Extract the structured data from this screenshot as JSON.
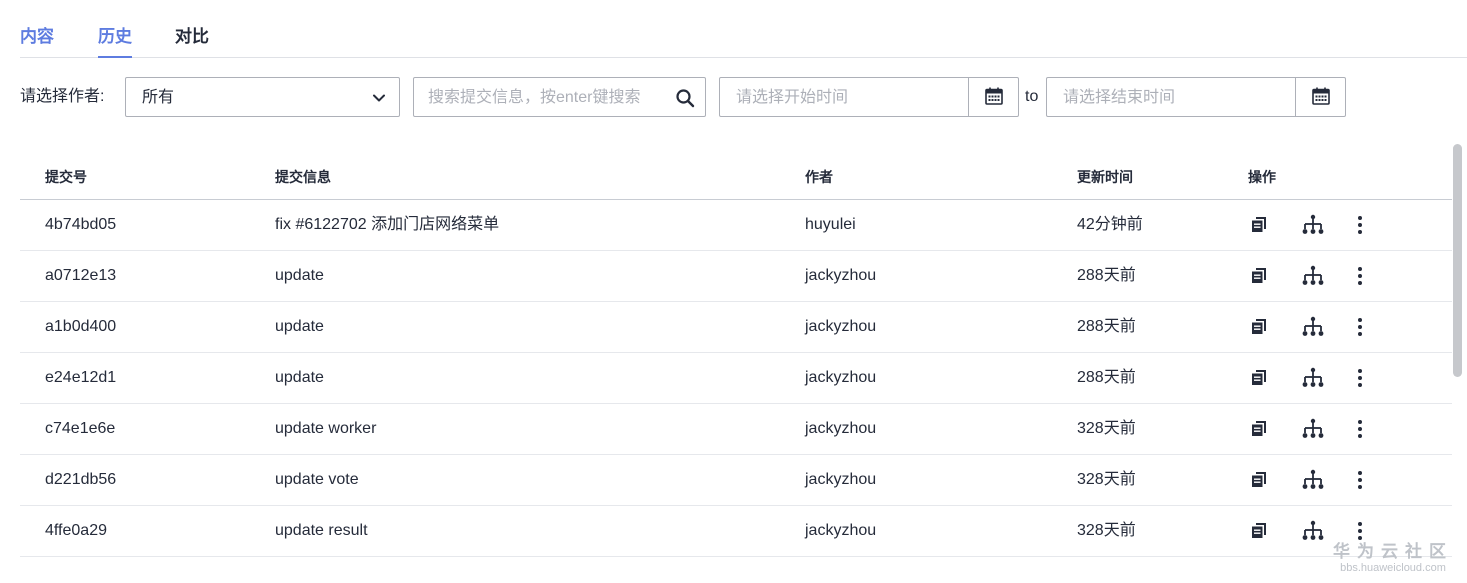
{
  "tabs": [
    {
      "label": "内容"
    },
    {
      "label": "历史"
    },
    {
      "label": "对比"
    }
  ],
  "filters": {
    "author_label": "请选择作者:",
    "author_value": "所有",
    "search_placeholder": "搜索提交信息，按enter键搜索",
    "start_placeholder": "请选择开始时间",
    "to_label": "to",
    "end_placeholder": "请选择结束时间"
  },
  "table": {
    "headers": [
      "提交号",
      "提交信息",
      "作者",
      "更新时间",
      "操作"
    ],
    "rows": [
      {
        "commit": "4b74bd05",
        "message": "fix #6122702 添加门店网络菜单",
        "author": "huyulei",
        "time": "42分钟前"
      },
      {
        "commit": "a0712e13",
        "message": "update",
        "author": "jackyzhou",
        "time": "288天前"
      },
      {
        "commit": "a1b0d400",
        "message": "update",
        "author": "jackyzhou",
        "time": "288天前"
      },
      {
        "commit": "e24e12d1",
        "message": "update",
        "author": "jackyzhou",
        "time": "288天前"
      },
      {
        "commit": "c74e1e6e",
        "message": "update worker",
        "author": "jackyzhou",
        "time": "328天前"
      },
      {
        "commit": "d221db56",
        "message": "update vote",
        "author": "jackyzhou",
        "time": "328天前"
      },
      {
        "commit": "4ffe0a29",
        "message": "update result",
        "author": "jackyzhou",
        "time": "328天前"
      }
    ]
  },
  "icons": {
    "view": "copy-icon",
    "tree": "branch-tree-icon",
    "more": "more-vertical-icon"
  },
  "watermark": {
    "title": "华为云社区",
    "url": "bbs.huaweicloud.com"
  },
  "colors": {
    "accent": "#5e7ce0",
    "text": "#252b3a",
    "border": "#adb0b8"
  }
}
